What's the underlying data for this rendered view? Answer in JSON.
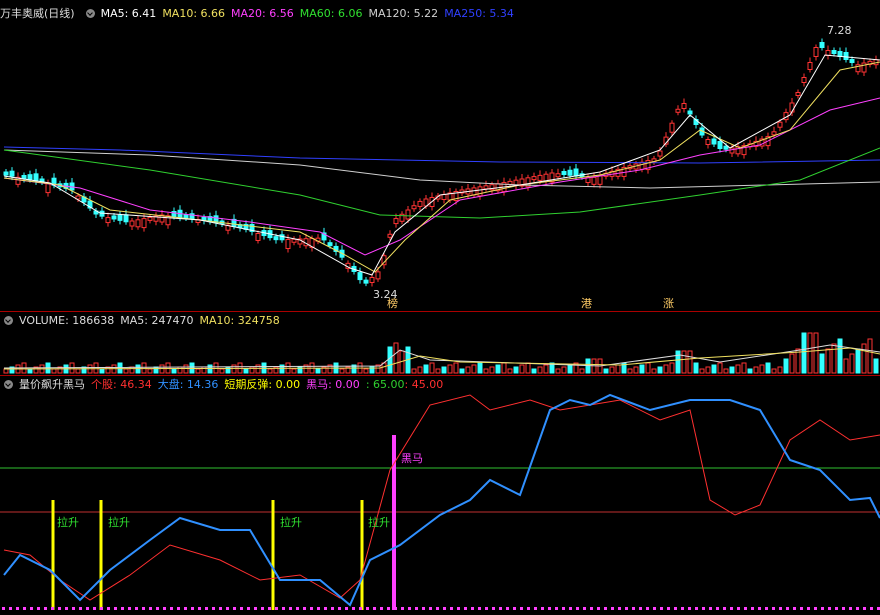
{
  "price_panel": {
    "title": "万丰奥威(日线)",
    "ma": [
      {
        "label": "MA5: 6.41",
        "color": "#ffffff"
      },
      {
        "label": "MA10: 6.66",
        "color": "#f0e060"
      },
      {
        "label": "MA20: 6.56",
        "color": "#ff40ff"
      },
      {
        "label": "MA60: 6.06",
        "color": "#30e030"
      },
      {
        "label": "MA120: 5.22",
        "color": "#d0d0d0"
      },
      {
        "label": "MA250: 5.34",
        "color": "#3040ff"
      }
    ],
    "high_label": "7.28",
    "low_label": "3.24",
    "markers": [
      "榜",
      "港",
      "涨"
    ]
  },
  "volume_panel": {
    "label": "VOLUME: 186638",
    "ma5": "MA5: 247470",
    "ma10": "MA10: 324758"
  },
  "indicator_panel": {
    "title": "量价飙升黑马",
    "items": [
      {
        "label": "个股: 46.34",
        "color": "#ff3030"
      },
      {
        "label": "大盘: 14.36",
        "color": "#3090ff"
      },
      {
        "label": "短期反弹: 0.00",
        "color": "#ffff00"
      },
      {
        "label": "黑马: 0.00",
        "color": "#ff40ff"
      },
      {
        "label": ": 65.00",
        "color": "#30d030"
      },
      {
        "label": ": 45.00",
        "color": "#ff3030"
      }
    ],
    "signal_label": "拉升",
    "horse_label": "黑马"
  },
  "colors": {
    "up": "#ff3333",
    "down": "#33ffff",
    "ma250": "#3040ff",
    "ma120": "#d0d0d0",
    "ma60": "#30d030",
    "ma20": "#ff40ff",
    "ma10": "#f0e060",
    "ma5": "#ffffff"
  }
}
